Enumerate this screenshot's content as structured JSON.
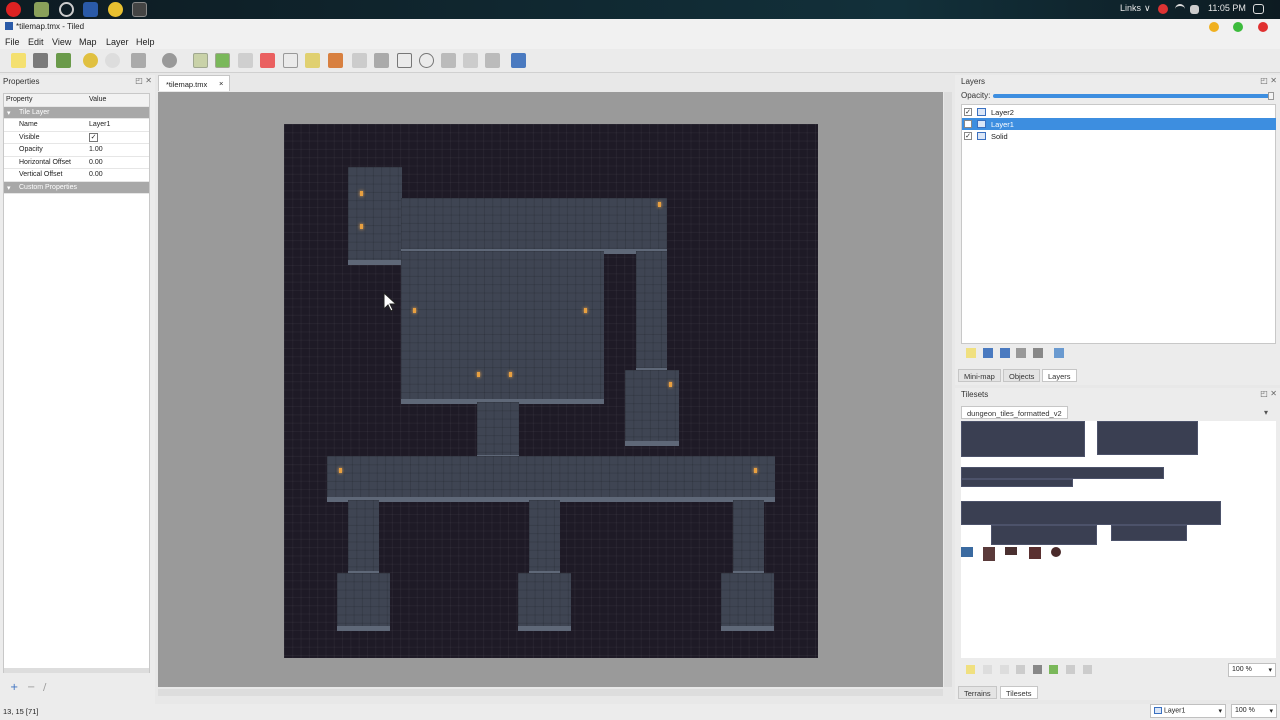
{
  "taskbar": {
    "links_label": "Links",
    "chevron": "∨",
    "time": "11:05 PM"
  },
  "window": {
    "title": "*tilemap.tmx - Tiled"
  },
  "menu": [
    "File",
    "Edit",
    "View",
    "Map",
    "Layer",
    "Help"
  ],
  "properties": {
    "panel_title": "Properties",
    "col_property": "Property",
    "col_value": "Value",
    "group_tile_layer": "Tile Layer",
    "rows": [
      {
        "name": "Name",
        "value": "Layer1"
      },
      {
        "name": "Visible",
        "value": "✓"
      },
      {
        "name": "Opacity",
        "value": "1.00"
      },
      {
        "name": "Horizontal Offset",
        "value": "0.00"
      },
      {
        "name": "Vertical Offset",
        "value": "0.00"
      }
    ],
    "group_custom": "Custom Properties"
  },
  "document_tab": {
    "label": "*tilemap.tmx",
    "close": "×"
  },
  "layers_panel": {
    "title": "Layers",
    "opacity_label": "Opacity:",
    "opacity_value": 1.0,
    "layers": [
      {
        "name": "Layer2",
        "visible": "✓",
        "selected": false
      },
      {
        "name": "Layer1",
        "visible": "✓",
        "selected": true
      },
      {
        "name": "Solid",
        "visible": "✓",
        "selected": false
      }
    ]
  },
  "dock_tabs_top": [
    "Mini-map",
    "Objects",
    "Layers"
  ],
  "tilesets_panel": {
    "title": "Tilesets",
    "tab": "dungeon_tiles_formatted_v2",
    "zoom": "100 %"
  },
  "dock_tabs_bottom": [
    "Terrains",
    "Tilesets"
  ],
  "status": {
    "coords": "13, 15 [71]",
    "layer": "Layer1",
    "zoom": "100 %"
  },
  "colors": {
    "selection": "#3d8ee0",
    "map_bg": "#1e1a26",
    "floor": "#3f4553"
  }
}
